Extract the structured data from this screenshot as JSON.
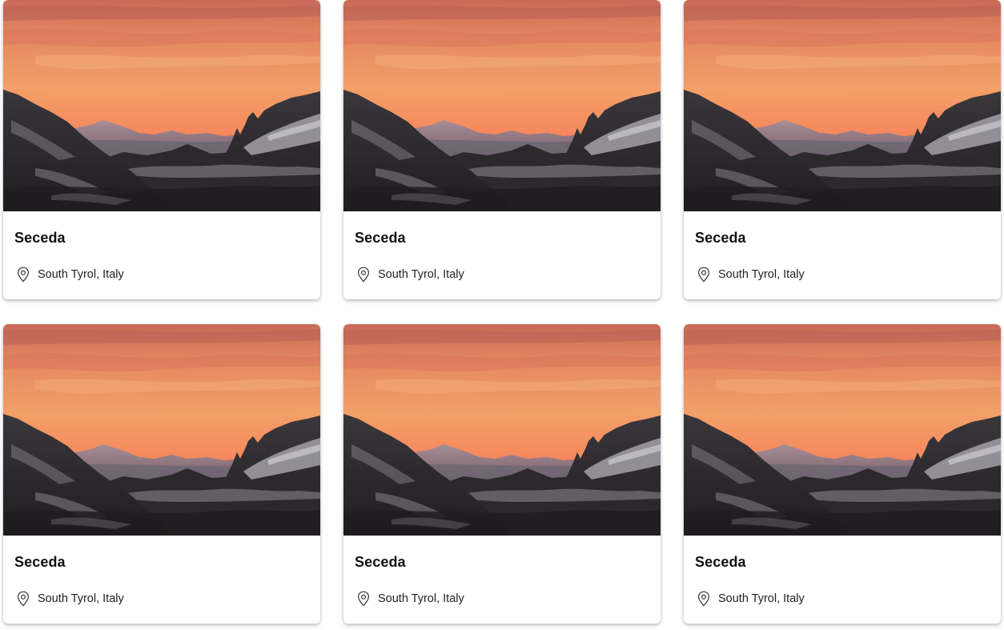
{
  "cards": [
    {
      "title": "Seceda",
      "location": "South Tyrol, Italy",
      "image": "mountain-sunset-photo"
    },
    {
      "title": "Seceda",
      "location": "South Tyrol, Italy",
      "image": "mountain-sunset-photo"
    },
    {
      "title": "Seceda",
      "location": "South Tyrol, Italy",
      "image": "mountain-sunset-photo"
    },
    {
      "title": "Seceda",
      "location": "South Tyrol, Italy",
      "image": "mountain-sunset-photo"
    },
    {
      "title": "Seceda",
      "location": "South Tyrol, Italy",
      "image": "mountain-sunset-photo"
    },
    {
      "title": "Seceda",
      "location": "South Tyrol, Italy",
      "image": "mountain-sunset-photo"
    }
  ],
  "colors": {
    "sky_top": "#d9735a",
    "sky_mid": "#f29a62",
    "sky_horizon": "#f7705a",
    "mountain_dark": "#262426",
    "snow": "#b4b1b7",
    "text": "#111111"
  },
  "icons": {
    "location": "map-pin-icon"
  }
}
